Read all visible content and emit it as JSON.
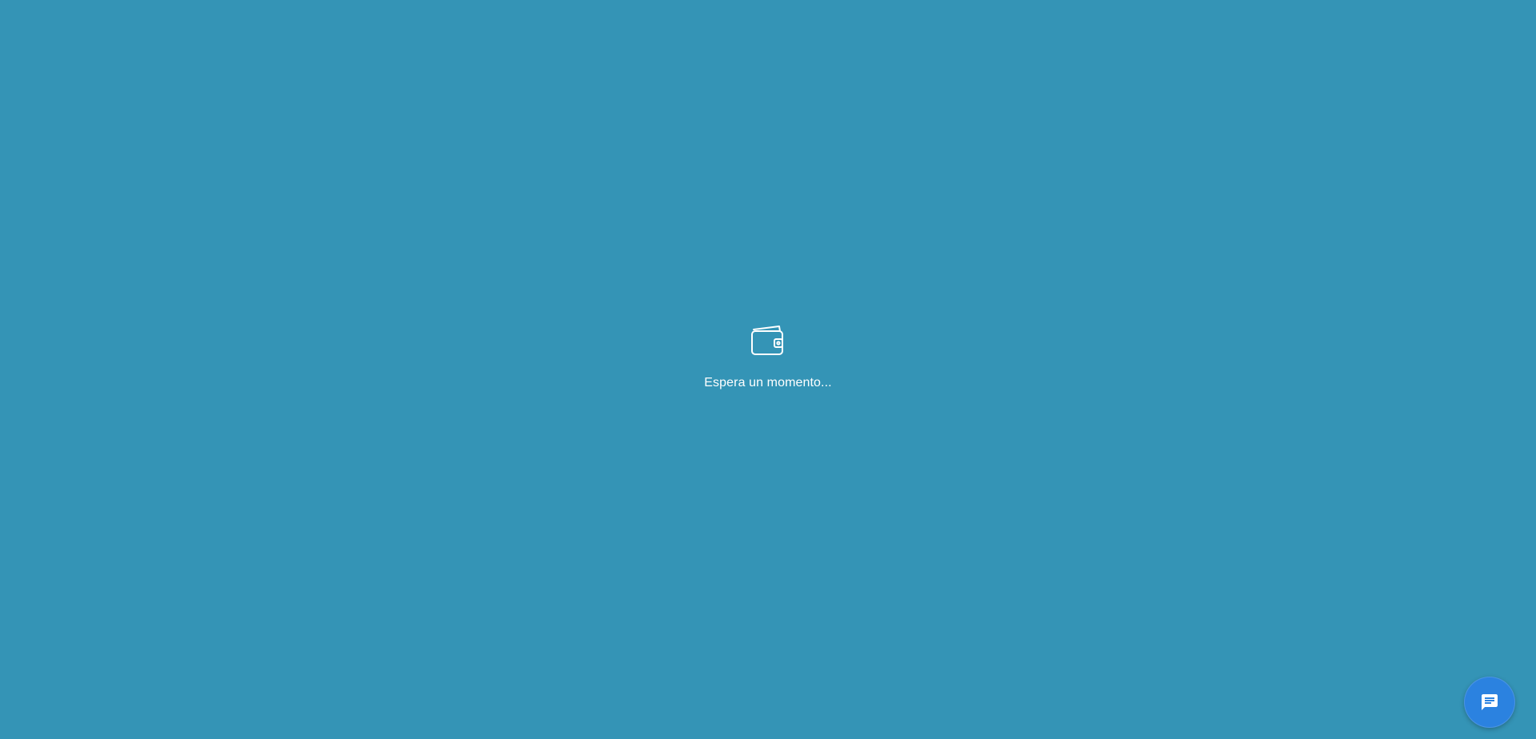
{
  "loader": {
    "icon": "wallet-icon",
    "message": "Espera un momento..."
  },
  "chat_launcher": {
    "icon": "chat-icon"
  },
  "colors": {
    "background": "#3494b6",
    "text": "#ffffff",
    "chat_button": "#2b82e0"
  }
}
